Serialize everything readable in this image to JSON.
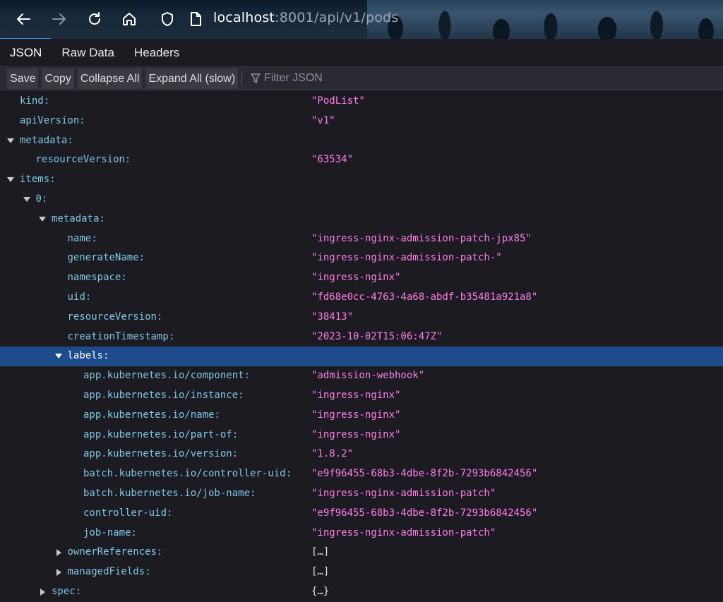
{
  "browser": {
    "url_host": "localhost",
    "url_path": ":8001/api/v1/pods"
  },
  "viewer_tabs": [
    "JSON",
    "Raw Data",
    "Headers"
  ],
  "toolbar": {
    "save_label": "Save",
    "copy_label": "Copy",
    "collapse_label": "Collapse All",
    "expand_label": "Expand All (slow)",
    "filter_placeholder": "Filter JSON"
  },
  "colors": {
    "key": "#7ec8e3",
    "string_value": "#ff7de9",
    "selected_row": "#1e4b8a",
    "active_tab_underline": "#3d8fe0"
  },
  "tree": [
    {
      "key": "kind:",
      "value": "\"PodList\"",
      "depth": 0,
      "toggle": "none"
    },
    {
      "key": "apiVersion:",
      "value": "\"v1\"",
      "depth": 0,
      "toggle": "none"
    },
    {
      "key": "metadata:",
      "value": "",
      "depth": 0,
      "toggle": "expanded"
    },
    {
      "key": "resourceVersion:",
      "value": "\"63534\"",
      "depth": 1,
      "toggle": "none"
    },
    {
      "key": "items:",
      "value": "",
      "depth": 0,
      "toggle": "expanded"
    },
    {
      "key": "0:",
      "value": "",
      "depth": 1,
      "toggle": "expanded"
    },
    {
      "key": "metadata:",
      "value": "",
      "depth": 2,
      "toggle": "expanded"
    },
    {
      "key": "name:",
      "value": "\"ingress-nginx-admission-patch-jpx85\"",
      "depth": 3,
      "toggle": "none"
    },
    {
      "key": "generateName:",
      "value": "\"ingress-nginx-admission-patch-\"",
      "depth": 3,
      "toggle": "none"
    },
    {
      "key": "namespace:",
      "value": "\"ingress-nginx\"",
      "depth": 3,
      "toggle": "none"
    },
    {
      "key": "uid:",
      "value": "\"fd68e0cc-4763-4a68-abdf-b35481a921a8\"",
      "depth": 3,
      "toggle": "none"
    },
    {
      "key": "resourceVersion:",
      "value": "\"38413\"",
      "depth": 3,
      "toggle": "none"
    },
    {
      "key": "creationTimestamp:",
      "value": "\"2023-10-02T15:06:47Z\"",
      "depth": 3,
      "toggle": "none"
    },
    {
      "key": "labels:",
      "value": "",
      "depth": 3,
      "toggle": "expanded",
      "selected": true
    },
    {
      "key": "app.kubernetes.io/component:",
      "value": "\"admission-webhook\"",
      "depth": 4,
      "toggle": "none"
    },
    {
      "key": "app.kubernetes.io/instance:",
      "value": "\"ingress-nginx\"",
      "depth": 4,
      "toggle": "none"
    },
    {
      "key": "app.kubernetes.io/name:",
      "value": "\"ingress-nginx\"",
      "depth": 4,
      "toggle": "none"
    },
    {
      "key": "app.kubernetes.io/part-of:",
      "value": "\"ingress-nginx\"",
      "depth": 4,
      "toggle": "none"
    },
    {
      "key": "app.kubernetes.io/version:",
      "value": "\"1.8.2\"",
      "depth": 4,
      "toggle": "none"
    },
    {
      "key": "batch.kubernetes.io/controller-uid:",
      "value": "\"e9f96455-68b3-4dbe-8f2b-7293b6842456\"",
      "depth": 4,
      "toggle": "none"
    },
    {
      "key": "batch.kubernetes.io/job-name:",
      "value": "\"ingress-nginx-admission-patch\"",
      "depth": 4,
      "toggle": "none"
    },
    {
      "key": "controller-uid:",
      "value": "\"e9f96455-68b3-4dbe-8f2b-7293b6842456\"",
      "depth": 4,
      "toggle": "none"
    },
    {
      "key": "job-name:",
      "value": "\"ingress-nginx-admission-patch\"",
      "depth": 4,
      "toggle": "none"
    },
    {
      "key": "ownerReferences:",
      "value": "[…]",
      "depth": 3,
      "toggle": "collapsed",
      "plain": true
    },
    {
      "key": "managedFields:",
      "value": "[…]",
      "depth": 3,
      "toggle": "collapsed",
      "plain": true
    },
    {
      "key": "spec:",
      "value": "{…}",
      "depth": 2,
      "toggle": "collapsed",
      "plain": true
    }
  ]
}
